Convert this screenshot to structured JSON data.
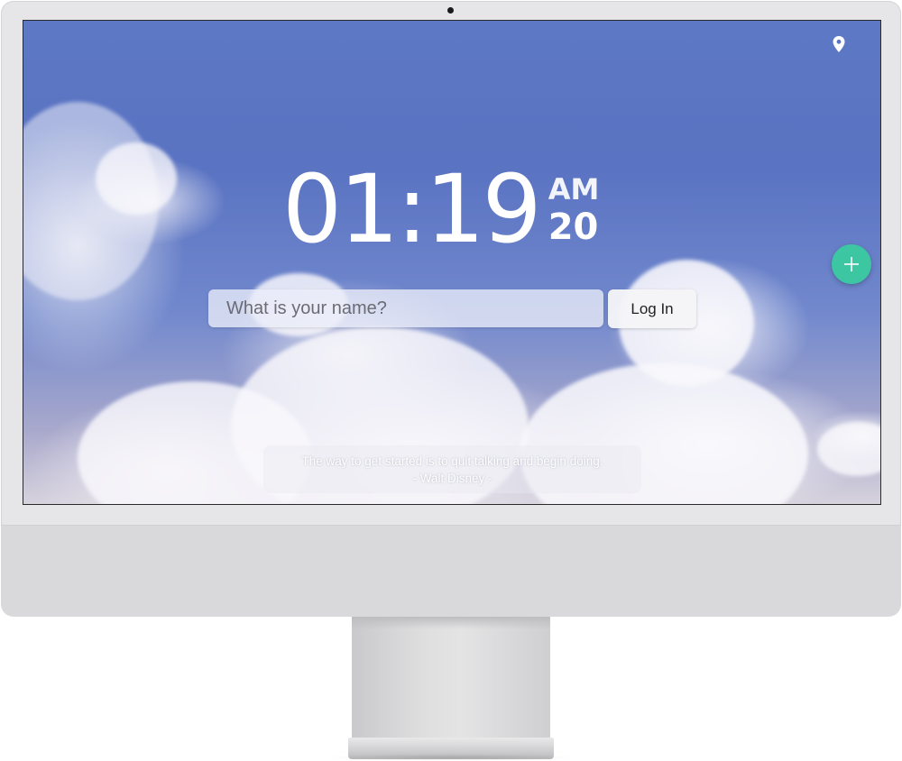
{
  "clock": {
    "time": "01:19",
    "ampm": "AM",
    "seconds": "20"
  },
  "login": {
    "name_placeholder": "What is your name?",
    "name_value": "",
    "button_label": "Log In"
  },
  "quote": {
    "text": "The way to get started is to quit talking and begin doing.",
    "author": "- Walt Disney -"
  },
  "icons": {
    "location": "location-pin-icon",
    "add": "plus-icon"
  },
  "colors": {
    "add_button": "#3cc7a2",
    "sky": "#5a73c2"
  }
}
